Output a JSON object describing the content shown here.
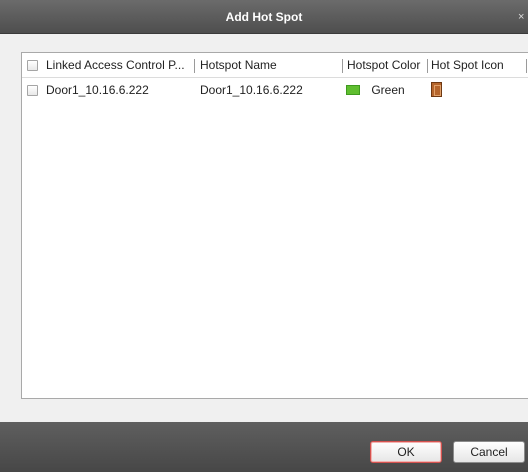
{
  "dialog": {
    "title": "Add Hot Spot",
    "close_glyph": "×"
  },
  "table": {
    "columns": [
      "Linked Access Control P...",
      "Hotspot Name",
      "Hotspot Color",
      "Hot Spot Icon"
    ],
    "rows": [
      {
        "access_control_point": "Door1_10.16.6.222",
        "hotspot_name": "Door1_10.16.6.222",
        "color_label": "Green",
        "color_hex": "#5fbe2f",
        "icon": "door-icon",
        "checked": false
      }
    ]
  },
  "footer": {
    "ok_label": "OK",
    "cancel_label": "Cancel"
  },
  "colors": {
    "titlebar": "#555555",
    "footer": "#505050",
    "ok_border": "#d5524f",
    "green_swatch": "#5fbe2f",
    "door_icon": "#b5652c"
  }
}
